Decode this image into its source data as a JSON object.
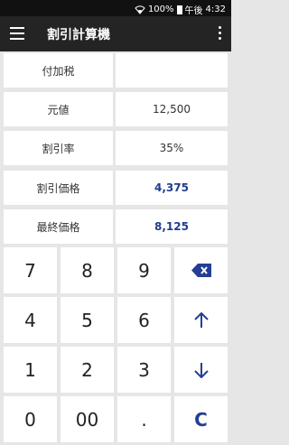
{
  "status": {
    "battery": "100%",
    "period": "午後",
    "time": "4:32"
  },
  "appbar": {
    "title": "割引計算機",
    "menu_icon": "hamburger-menu-icon",
    "more_icon": "more-vert-icon"
  },
  "rows": [
    {
      "label": "付加税",
      "value": ""
    },
    {
      "label": "元値",
      "value": "12,500"
    },
    {
      "label": "割引率",
      "value": "35%"
    },
    {
      "label": "割引価格",
      "value": "4,375"
    },
    {
      "label": "最終価格",
      "value": "8,125"
    }
  ],
  "keypad": {
    "keys": [
      "7",
      "8",
      "9",
      "",
      "4",
      "5",
      "6",
      "",
      "1",
      "2",
      "3",
      "",
      "0",
      "00",
      ".",
      "C"
    ],
    "icons": {
      "backspace": "backspace-icon",
      "up": "arrow-up-icon",
      "down": "arrow-down-icon"
    }
  },
  "colors": {
    "accent": "#1f3c8f",
    "appbar": "#242424",
    "background": "#e6e6e6"
  }
}
